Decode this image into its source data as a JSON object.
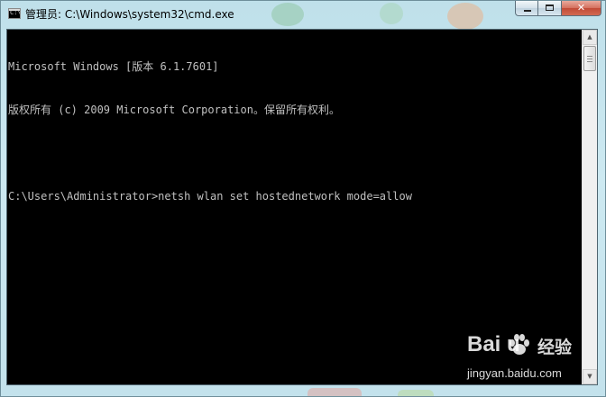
{
  "window": {
    "title": "管理员: C:\\Windows\\system32\\cmd.exe",
    "app_icon": "cmd-icon",
    "app_icon_glyph": "C:\\",
    "buttons": {
      "minimize": {
        "icon": "minimize-icon"
      },
      "maximize": {
        "icon": "maximize-icon"
      },
      "close": {
        "icon": "close-icon",
        "glyph": "✕"
      }
    }
  },
  "console": {
    "background": "#000000",
    "foreground": "#c0c0c0",
    "lines": [
      "Microsoft Windows [版本 6.1.7601]",
      "版权所有 (c) 2009 Microsoft Corporation。保留所有权利。",
      "",
      "C:\\Users\\Administrator>netsh wlan set hostednetwork mode=allow"
    ]
  },
  "scrollbar": {
    "up_glyph": "▲",
    "down_glyph": "▼"
  },
  "watermark": {
    "logo": "Bai  u",
    "brand_cn": "经验",
    "url": "jingyan.baidu.com"
  }
}
